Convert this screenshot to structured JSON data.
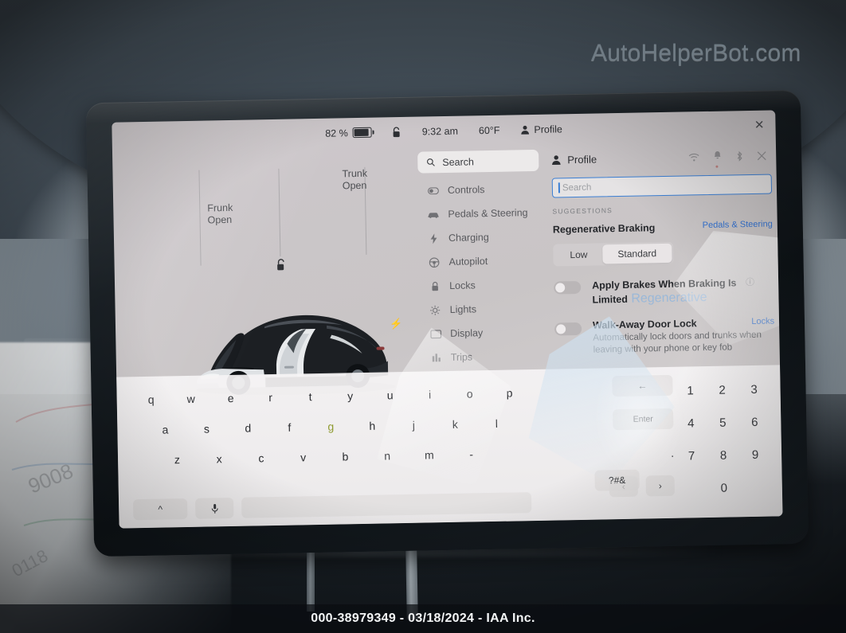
{
  "photo": {
    "watermark": "AutoHelperBot.com",
    "footer": "000-38979349 - 03/18/2024 - IAA Inc."
  },
  "statusbar": {
    "battery_percent": "82 %",
    "battery_icon": "battery-icon",
    "lock_icon": "unlock-icon",
    "time": "9:32 am",
    "temperature": "60°F",
    "profile_icon": "person-icon",
    "profile_label": "Profile",
    "close_icon": "close-icon"
  },
  "car": {
    "frunk_label": "Frunk\nOpen",
    "frunk_line1": "Frunk",
    "frunk_line2": "Open",
    "trunk_line1": "Trunk",
    "trunk_line2": "Open",
    "unlock_icon": "unlock-icon",
    "charge_icon": "charge-bolt-icon"
  },
  "menu": {
    "search": {
      "label": "Search",
      "icon": "search-icon"
    },
    "items": [
      {
        "label": "Controls",
        "icon": "controls-icon"
      },
      {
        "label": "Pedals & Steering",
        "icon": "car-icon"
      },
      {
        "label": "Charging",
        "icon": "bolt-icon"
      },
      {
        "label": "Autopilot",
        "icon": "steering-wheel-icon"
      },
      {
        "label": "Locks",
        "icon": "lock-icon"
      },
      {
        "label": "Lights",
        "icon": "light-icon"
      },
      {
        "label": "Display",
        "icon": "display-icon"
      },
      {
        "label": "Trips",
        "icon": "trips-icon"
      }
    ]
  },
  "panel": {
    "title": "Profile",
    "title_icon": "person-icon",
    "icons": [
      "wifi-icon",
      "bell-icon",
      "bluetooth-icon",
      "close-icon"
    ],
    "search_placeholder": "Search",
    "search_value": "",
    "suggestions_label": "SUGGESTIONS",
    "suggestion_1": {
      "title": "Regenerative Braking",
      "link": "Pedals & Steering",
      "segment_options": [
        "Low",
        "Standard"
      ],
      "segment_selected": "Standard"
    },
    "setting_1": {
      "title": "Apply Brakes When Braking Is Limited",
      "ghost_text": "Regenerative",
      "info_icon": "info-icon",
      "toggle": "off"
    },
    "setting_2": {
      "title": "Walk-Away Door Lock",
      "subtitle": "Automatically lock doors and trunks when leaving with your phone or key fob",
      "link": "Locks",
      "toggle": "off"
    }
  },
  "keyboard": {
    "row1": [
      "q",
      "w",
      "e",
      "r",
      "t",
      "y",
      "u",
      "i",
      "o",
      "p"
    ],
    "row2": [
      "a",
      "s",
      "d",
      "f",
      "g",
      "h",
      "j",
      "k",
      "l"
    ],
    "row3": [
      "z",
      "x",
      "c",
      "v",
      "b",
      "n",
      "m",
      "-"
    ],
    "shift_label": "^",
    "mic_icon": "microphone-icon",
    "space_label": "",
    "symbols_label": "?#&",
    "backspace_label": "←",
    "enter_label": "Enter",
    "prev_label": "‹",
    "next_label": "›",
    "period_label": ".",
    "numpad": [
      [
        "1",
        "2",
        "3"
      ],
      [
        "4",
        "5",
        "6"
      ],
      [
        "7",
        "8",
        "9"
      ],
      [
        "",
        "0",
        ""
      ]
    ]
  },
  "colors": {
    "accent_blue": "#2f6fd0",
    "focus_blue": "#3b7fd4",
    "screen_bg": "#cbc6c9",
    "text_dark": "#24262a"
  }
}
